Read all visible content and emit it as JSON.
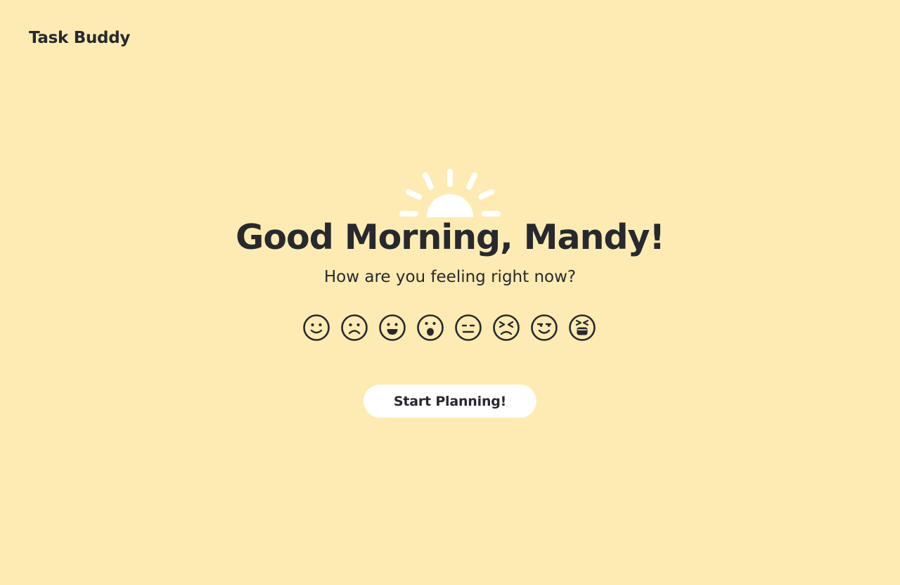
{
  "app": {
    "brand": "Task Buddy"
  },
  "hero": {
    "icon": "sunrise-icon",
    "greeting": "Good Morning, Mandy!",
    "prompt": "How are you feeling right now?"
  },
  "moods": [
    {
      "icon": "smiling-face-icon"
    },
    {
      "icon": "frowning-face-icon"
    },
    {
      "icon": "grinning-face-icon"
    },
    {
      "icon": "surprised-face-icon"
    },
    {
      "icon": "expressionless-face-icon"
    },
    {
      "icon": "angry-face-icon"
    },
    {
      "icon": "smirking-face-icon"
    },
    {
      "icon": "laughing-face-icon"
    }
  ],
  "actions": {
    "start_label": "Start Planning!"
  },
  "colors": {
    "background": "#FEEBB3",
    "text": "#27292E",
    "button": "#FFFFFF",
    "sun": "#FFFFFF"
  }
}
